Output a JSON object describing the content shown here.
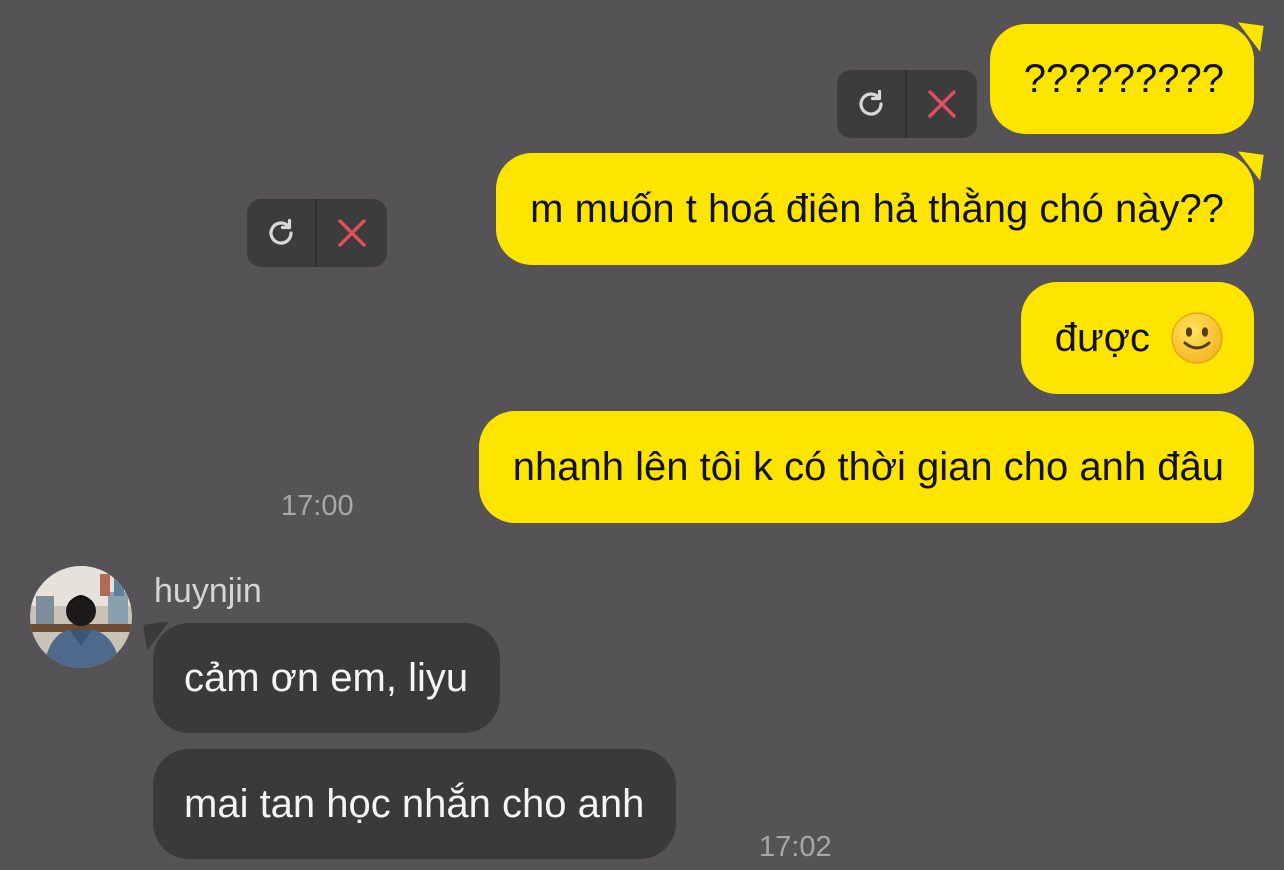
{
  "messages": {
    "sent": [
      {
        "text": "?????????"
      },
      {
        "text": "m muốn t hoá điên hả thằng chó này??"
      },
      {
        "text": "được"
      },
      {
        "text": "nhanh lên tôi k có thời gian cho anh đâu"
      }
    ],
    "sent_time": "17:00",
    "received": {
      "sender": "huynjin",
      "items": [
        {
          "text": "cảm ơn em, liyu"
        },
        {
          "text": "mai tan học nhắn cho anh"
        }
      ],
      "time": "17:02"
    }
  },
  "icons": {
    "retry": "retry-icon",
    "delete": "close-icon",
    "emoji": "slightly-smiling-face-emoji"
  },
  "colors": {
    "background": "#555355",
    "sent_bubble": "#fee500",
    "received_bubble": "#3a393b",
    "delete_x": "#e0505a"
  }
}
